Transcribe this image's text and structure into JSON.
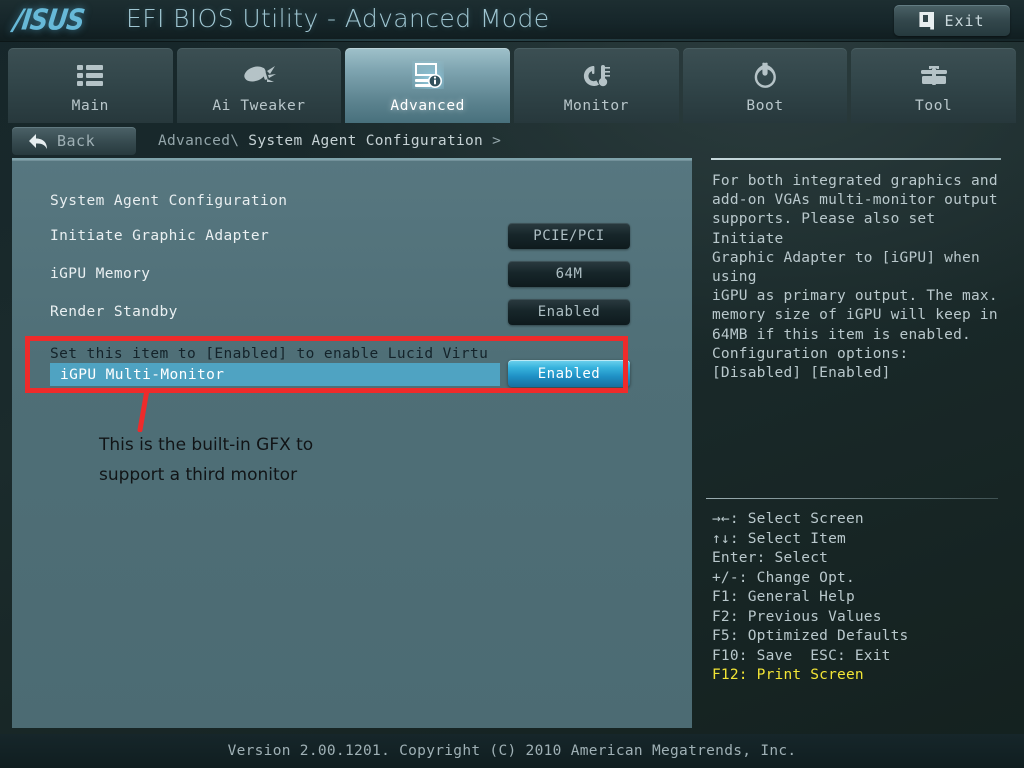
{
  "titlebar": {
    "brand": "/ISUS",
    "title": "EFI BIOS Utility - Advanced Mode",
    "exit_label": "Exit"
  },
  "nav": {
    "tabs": [
      {
        "label": "Main",
        "icon": "list-icon",
        "active": false
      },
      {
        "label": "Ai Tweaker",
        "icon": "rocket-icon",
        "active": false
      },
      {
        "label": "Advanced",
        "icon": "monitor-info-icon",
        "active": true
      },
      {
        "label": "Monitor",
        "icon": "gauge-temp-icon",
        "active": false
      },
      {
        "label": "Boot",
        "icon": "power-icon",
        "active": false
      },
      {
        "label": "Tool",
        "icon": "toolbox-icon",
        "active": false
      }
    ]
  },
  "backrow": {
    "back_label": "Back",
    "breadcrumb_parent": "Advanced\\",
    "breadcrumb_current": " System Agent Configuration ",
    "breadcrumb_caret": ">"
  },
  "main": {
    "section_title": "System Agent Configuration",
    "rows": [
      {
        "name": "Initiate Graphic Adapter",
        "value": "PCIE/PCI"
      },
      {
        "name": "iGPU Memory",
        "value": "64M"
      },
      {
        "name": "Render Standby",
        "value": "Enabled"
      }
    ],
    "selected": {
      "hint": "Set this item to [Enabled] to enable Lucid Virtu",
      "name": "iGPU Multi-Monitor",
      "value": "Enabled"
    }
  },
  "annotation": {
    "line1": "This is the built-in GFX to",
    "line2": "support a third monitor",
    "box_color": "#ee2b2b"
  },
  "help": {
    "text": "For both integrated graphics and\nadd-on VGAs multi-monitor output\nsupports. Please also set Initiate\nGraphic Adapter to [iGPU] when using\niGPU as primary output. The max.\nmemory size of iGPU will keep in\n64MB if this item is enabled.\nConfiguration options:\n[Disabled] [Enabled]",
    "keys": [
      {
        "text": "→←: Select Screen",
        "highlight": false
      },
      {
        "text": "↑↓: Select Item",
        "highlight": false
      },
      {
        "text": "Enter: Select",
        "highlight": false
      },
      {
        "text": "+/-: Change Opt.",
        "highlight": false
      },
      {
        "text": "F1: General Help",
        "highlight": false
      },
      {
        "text": "F2: Previous Values",
        "highlight": false
      },
      {
        "text": "F5: Optimized Defaults",
        "highlight": false
      },
      {
        "text": "F10: Save  ESC: Exit",
        "highlight": false
      },
      {
        "text": "F12: Print Screen",
        "highlight": true
      }
    ]
  },
  "footer": {
    "version": "Version 2.00.1201. Copyright (C) 2010 American Megatrends, Inc."
  },
  "colors": {
    "accent_blue": "#4fa3c2",
    "panel_bg": "#4f6f77",
    "highlight_yellow": "#f2e535",
    "annotation_red": "#ee2b2b"
  }
}
